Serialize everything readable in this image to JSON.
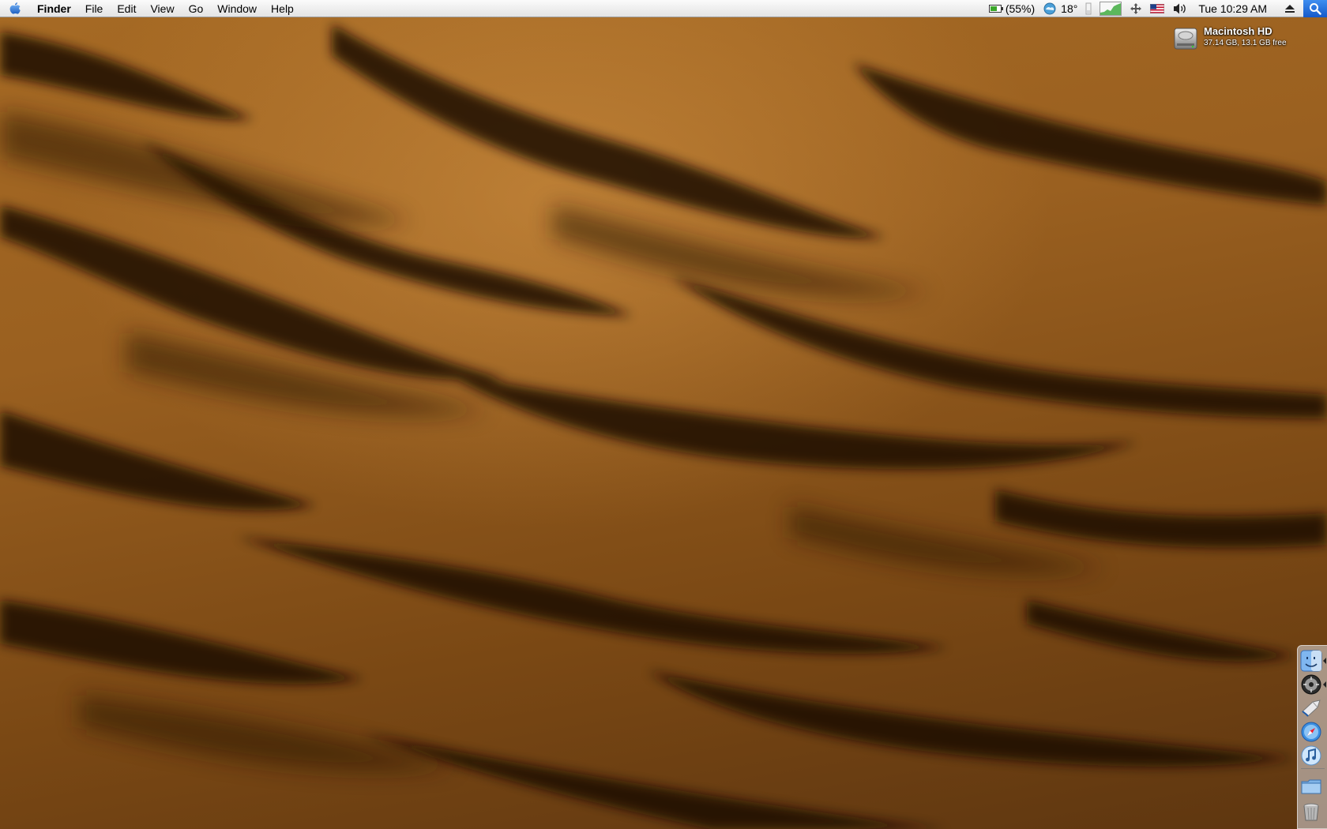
{
  "menubar": {
    "app_name": "Finder",
    "menus": [
      "File",
      "Edit",
      "View",
      "Go",
      "Window",
      "Help"
    ],
    "battery_percent": "(55%)",
    "weather_temp": "18°",
    "clock": "Tue 10:29 AM"
  },
  "desktop": {
    "drive": {
      "name": "Macintosh HD",
      "info": "37.14 GB, 13.1 GB free"
    }
  },
  "dock": {
    "items": [
      "finder-icon",
      "dvd-player-icon",
      "mail-icon",
      "safari-icon",
      "itunes-icon",
      "folder-icon",
      "trash-icon"
    ]
  },
  "colors": {
    "fur_base": "#9a6020",
    "stripe": "#1a0c04",
    "menubar": "#efefef"
  }
}
